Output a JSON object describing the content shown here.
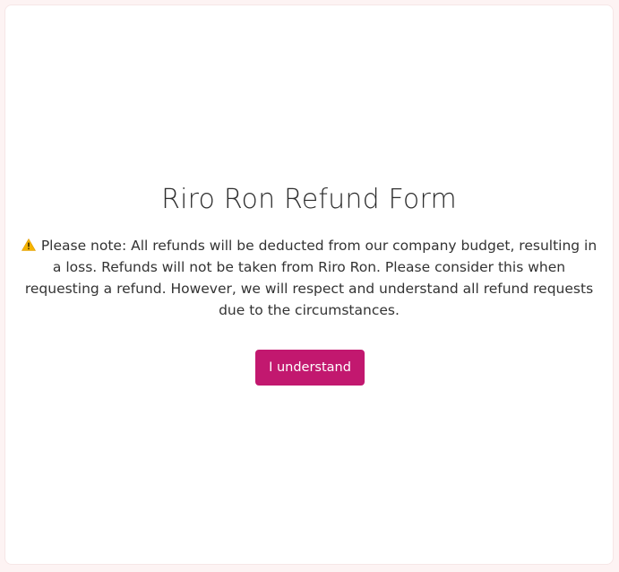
{
  "form": {
    "title": "Riro Ron Refund Form",
    "warning_icon": "warning-icon",
    "notice": "Please note: All refunds will be deducted from our company budget, resulting in a loss. Refunds will not be taken from Riro Ron. Please consider this when requesting a refund. However, we will respect and understand all refund requests due to the circumstances.",
    "button_label": "I understand"
  },
  "colors": {
    "accent": "#c2186f",
    "background": "#fdf3f3",
    "card": "#ffffff",
    "warning": "#f5b400"
  }
}
